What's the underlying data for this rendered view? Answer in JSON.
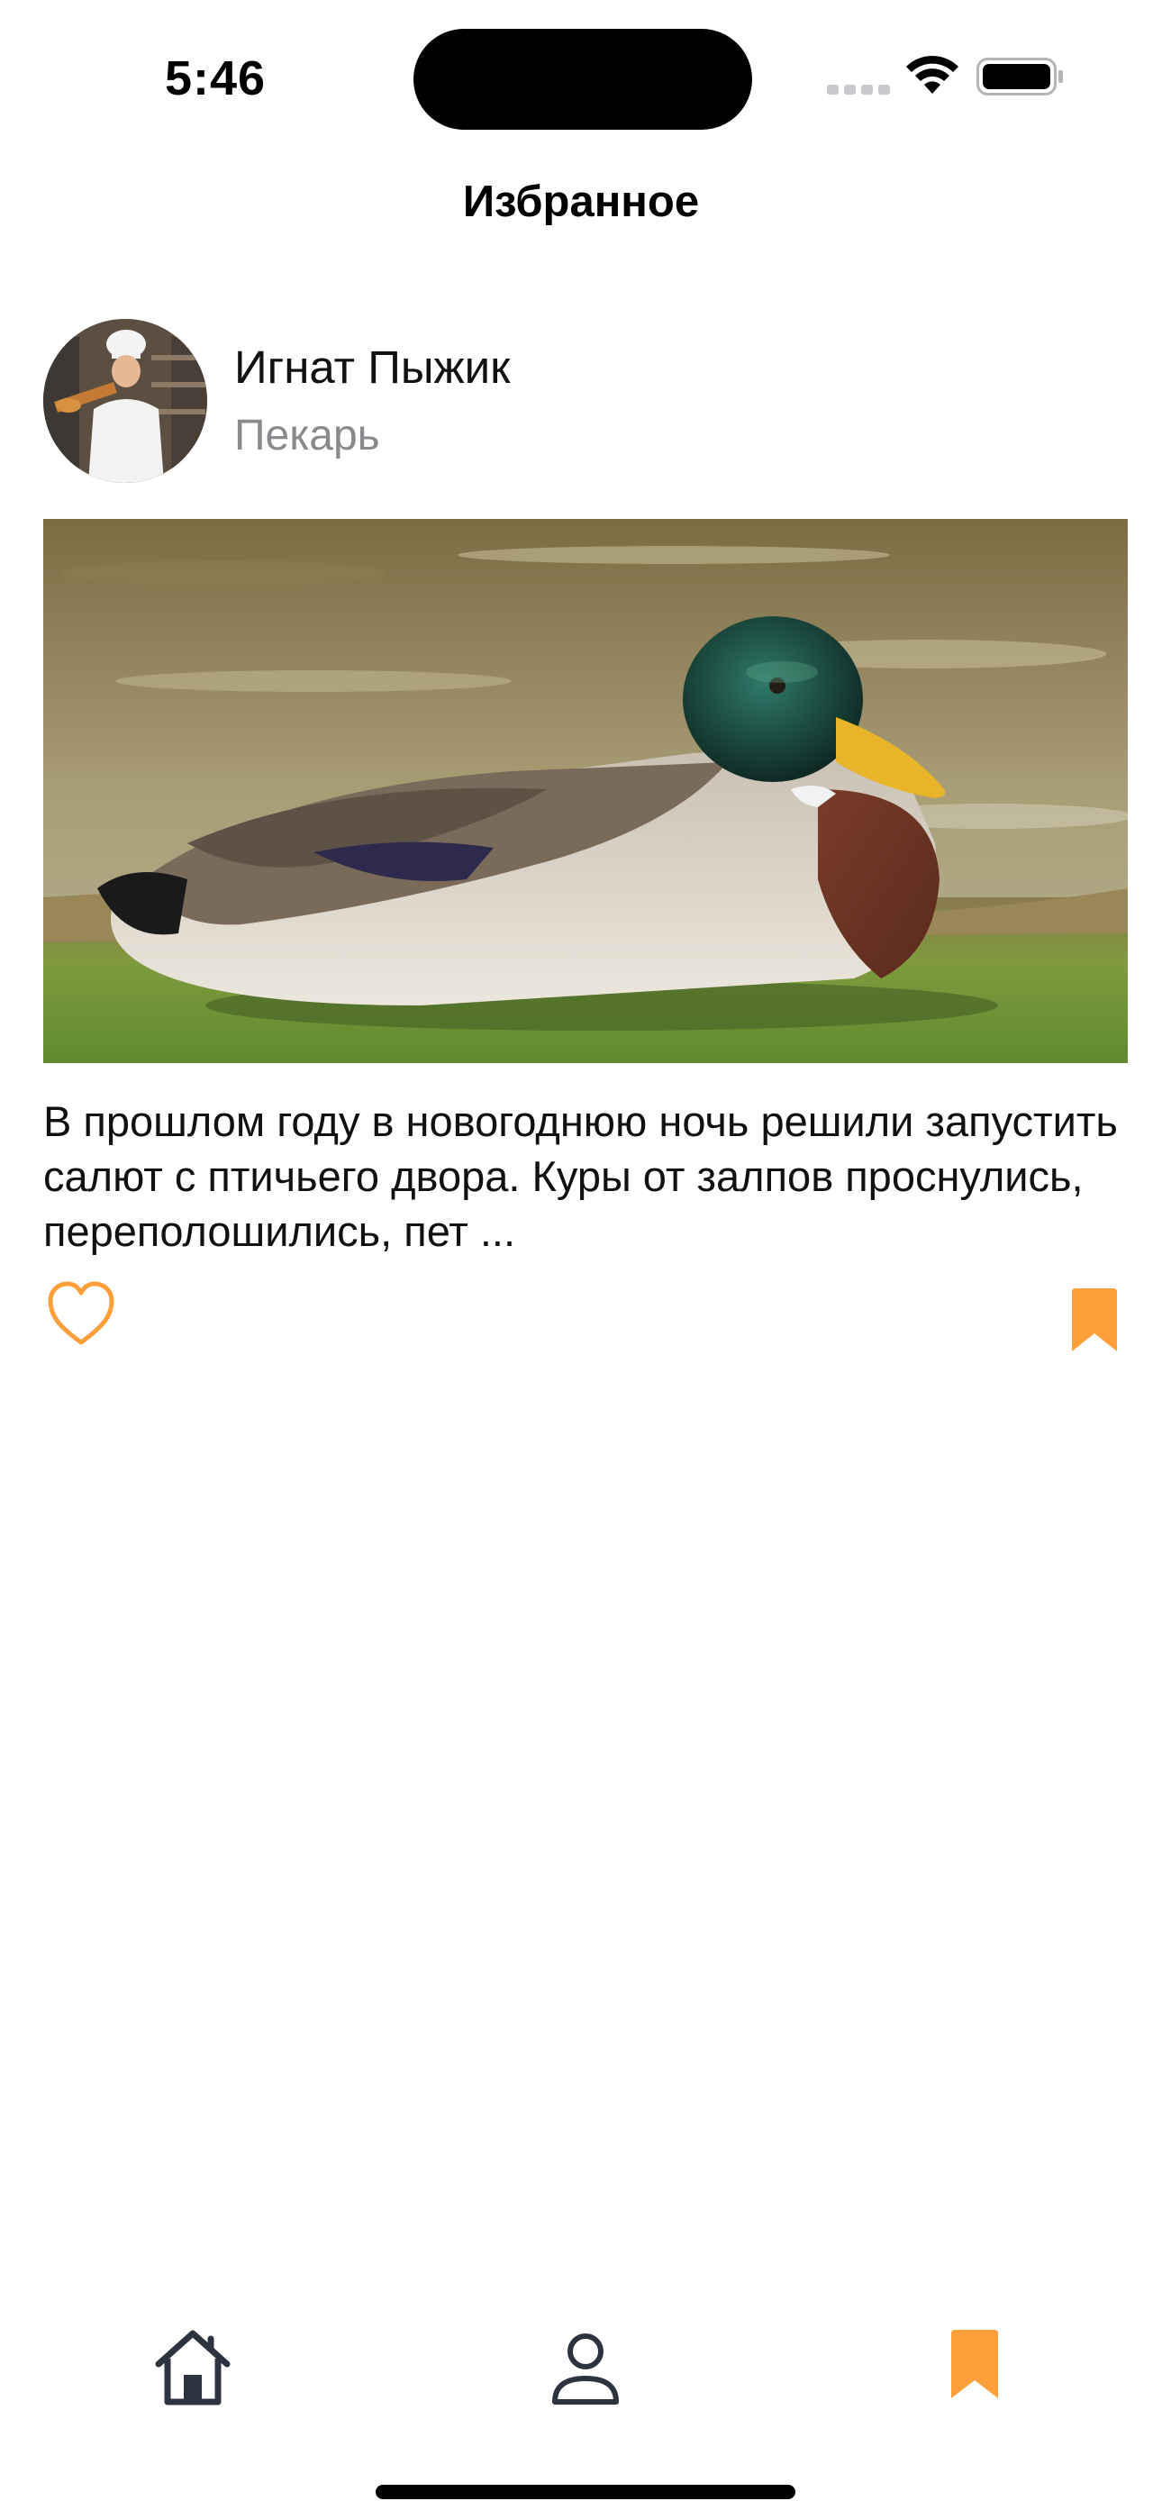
{
  "status_bar": {
    "time": "5:46"
  },
  "nav": {
    "title": "Избранное"
  },
  "post": {
    "author_name": "Игнат Пыжик",
    "author_role": "Пекарь",
    "avatar_icon": "baker-avatar",
    "image_icon": "mallard-duck-photo",
    "text": "В прошлом году в новогоднюю ночь решили запустить салют с птичьего двора. Куры от залпов проснулись, переполошились, пет ...",
    "like_icon": "heart-outline-icon",
    "bookmark_icon": "bookmark-filled-icon"
  },
  "tab_bar": {
    "items": [
      {
        "icon": "home-icon",
        "active": false
      },
      {
        "icon": "profile-icon",
        "active": false
      },
      {
        "icon": "bookmark-icon",
        "active": true
      }
    ]
  },
  "colors": {
    "accent": "#FF9F3A",
    "inactive_tab": "#2C3440",
    "secondary_text": "#8A8A8E"
  }
}
